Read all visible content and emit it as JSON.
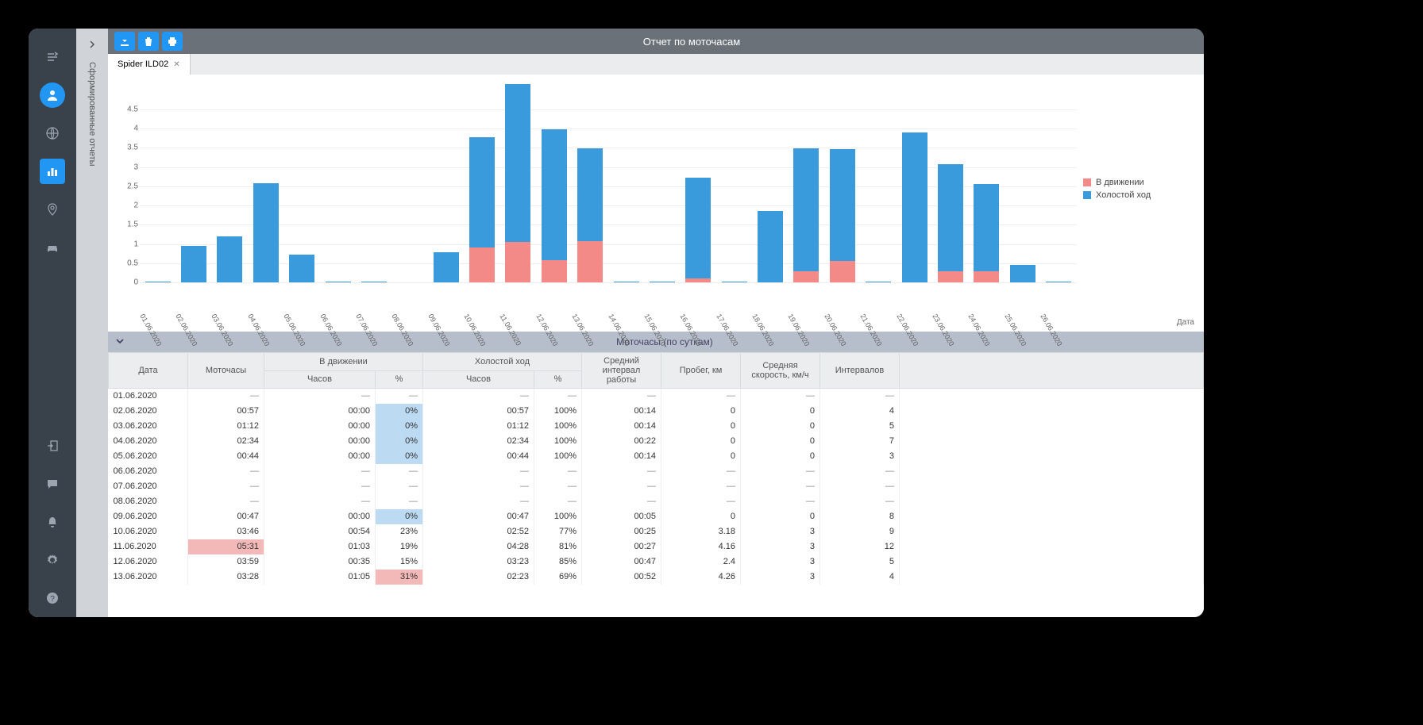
{
  "sidebar": {
    "panel_label": "Сформированные отчеты"
  },
  "toolbar": {
    "title": "Отчет по моточасам"
  },
  "tab": {
    "label": "Spider ILD02"
  },
  "legend": {
    "moving": "В движении",
    "idle": "Холостой ход"
  },
  "axis": {
    "xlabel": "Дата"
  },
  "chart_data": {
    "type": "bar",
    "title": "Отчет по моточасам",
    "xlabel": "Дата",
    "ylabel": "",
    "ylim": [
      0,
      5.2
    ],
    "yticks": [
      0,
      0.5,
      1,
      1.5,
      2,
      2.5,
      3,
      3.5,
      4,
      4.5
    ],
    "categories": [
      "01.06.2020",
      "02.06.2020",
      "03.06.2020",
      "04.06.2020",
      "05.06.2020",
      "06.06.2020",
      "07.06.2020",
      "08.06.2020",
      "09.06.2020",
      "10.06.2020",
      "11.06.2020",
      "12.06.2020",
      "13.06.2020",
      "14.06.2020",
      "15.06.2020",
      "16.06.2020",
      "17.06.2020",
      "18.06.2020",
      "19.06.2020",
      "20.06.2020",
      "21.06.2020",
      "22.06.2020",
      "23.06.2020",
      "24.06.2020",
      "25.06.2020",
      "26.06.2020"
    ],
    "series": [
      {
        "name": "В движении",
        "color": "#f48a88",
        "values": [
          0,
          0,
          0,
          0,
          0,
          0,
          0,
          0,
          0,
          0.9,
          1.05,
          0.58,
          1.08,
          0,
          0,
          0.1,
          0,
          0,
          0.28,
          0.55,
          0,
          0,
          0.28,
          0.28,
          0,
          0
        ]
      },
      {
        "name": "Холостой ход",
        "color": "#3a9bdc",
        "values": [
          0.03,
          0.95,
          1.2,
          2.57,
          0.73,
          0.03,
          0.02,
          0,
          0.78,
          2.87,
          4.1,
          3.4,
          2.4,
          0.03,
          0.02,
          2.63,
          0.03,
          1.85,
          3.2,
          2.92,
          0.02,
          3.9,
          2.8,
          2.27,
          0.45,
          0.02
        ]
      }
    ]
  },
  "table": {
    "title": "Моточасы (по суткам)",
    "headers": {
      "date": "Дата",
      "hours": "Моточасы",
      "moving": "В движении",
      "idle": "Холостой ход",
      "avg_interval": "Средний интервал работы",
      "mileage": "Пробег, км",
      "avg_speed": "Средняя скорость, км/ч",
      "intervals": "Интервалов",
      "sub_hours": "Часов",
      "sub_pct": "%"
    },
    "rows": [
      {
        "date": "01.06.2020",
        "hours": "—",
        "mh": "—",
        "mp": "—",
        "ih": "—",
        "ip": "—",
        "ai": "—",
        "ml": "—",
        "as": "—",
        "iv": "—",
        "mp_hl": "",
        "hours_hl": ""
      },
      {
        "date": "02.06.2020",
        "hours": "00:57",
        "mh": "00:00",
        "mp": "0%",
        "ih": "00:57",
        "ip": "100%",
        "ai": "00:14",
        "ml": "0",
        "as": "0",
        "iv": "4",
        "mp_hl": "blue",
        "hours_hl": ""
      },
      {
        "date": "03.06.2020",
        "hours": "01:12",
        "mh": "00:00",
        "mp": "0%",
        "ih": "01:12",
        "ip": "100%",
        "ai": "00:14",
        "ml": "0",
        "as": "0",
        "iv": "5",
        "mp_hl": "blue",
        "hours_hl": ""
      },
      {
        "date": "04.06.2020",
        "hours": "02:34",
        "mh": "00:00",
        "mp": "0%",
        "ih": "02:34",
        "ip": "100%",
        "ai": "00:22",
        "ml": "0",
        "as": "0",
        "iv": "7",
        "mp_hl": "blue",
        "hours_hl": ""
      },
      {
        "date": "05.06.2020",
        "hours": "00:44",
        "mh": "00:00",
        "mp": "0%",
        "ih": "00:44",
        "ip": "100%",
        "ai": "00:14",
        "ml": "0",
        "as": "0",
        "iv": "3",
        "mp_hl": "blue",
        "hours_hl": ""
      },
      {
        "date": "06.06.2020",
        "hours": "—",
        "mh": "—",
        "mp": "—",
        "ih": "—",
        "ip": "—",
        "ai": "—",
        "ml": "—",
        "as": "—",
        "iv": "—",
        "mp_hl": "",
        "hours_hl": ""
      },
      {
        "date": "07.06.2020",
        "hours": "—",
        "mh": "—",
        "mp": "—",
        "ih": "—",
        "ip": "—",
        "ai": "—",
        "ml": "—",
        "as": "—",
        "iv": "—",
        "mp_hl": "",
        "hours_hl": ""
      },
      {
        "date": "08.06.2020",
        "hours": "—",
        "mh": "—",
        "mp": "—",
        "ih": "—",
        "ip": "—",
        "ai": "—",
        "ml": "—",
        "as": "—",
        "iv": "—",
        "mp_hl": "",
        "hours_hl": ""
      },
      {
        "date": "09.06.2020",
        "hours": "00:47",
        "mh": "00:00",
        "mp": "0%",
        "ih": "00:47",
        "ip": "100%",
        "ai": "00:05",
        "ml": "0",
        "as": "0",
        "iv": "8",
        "mp_hl": "blue",
        "hours_hl": ""
      },
      {
        "date": "10.06.2020",
        "hours": "03:46",
        "mh": "00:54",
        "mp": "23%",
        "ih": "02:52",
        "ip": "77%",
        "ai": "00:25",
        "ml": "3.18",
        "as": "3",
        "iv": "9",
        "mp_hl": "",
        "hours_hl": ""
      },
      {
        "date": "11.06.2020",
        "hours": "05:31",
        "mh": "01:03",
        "mp": "19%",
        "ih": "04:28",
        "ip": "81%",
        "ai": "00:27",
        "ml": "4.16",
        "as": "3",
        "iv": "12",
        "mp_hl": "",
        "hours_hl": "pink"
      },
      {
        "date": "12.06.2020",
        "hours": "03:59",
        "mh": "00:35",
        "mp": "15%",
        "ih": "03:23",
        "ip": "85%",
        "ai": "00:47",
        "ml": "2.4",
        "as": "3",
        "iv": "5",
        "mp_hl": "",
        "hours_hl": ""
      },
      {
        "date": "13.06.2020",
        "hours": "03:28",
        "mh": "01:05",
        "mp": "31%",
        "ih": "02:23",
        "ip": "69%",
        "ai": "00:52",
        "ml": "4.26",
        "as": "3",
        "iv": "4",
        "mp_hl": "pink",
        "hours_hl": ""
      }
    ]
  }
}
